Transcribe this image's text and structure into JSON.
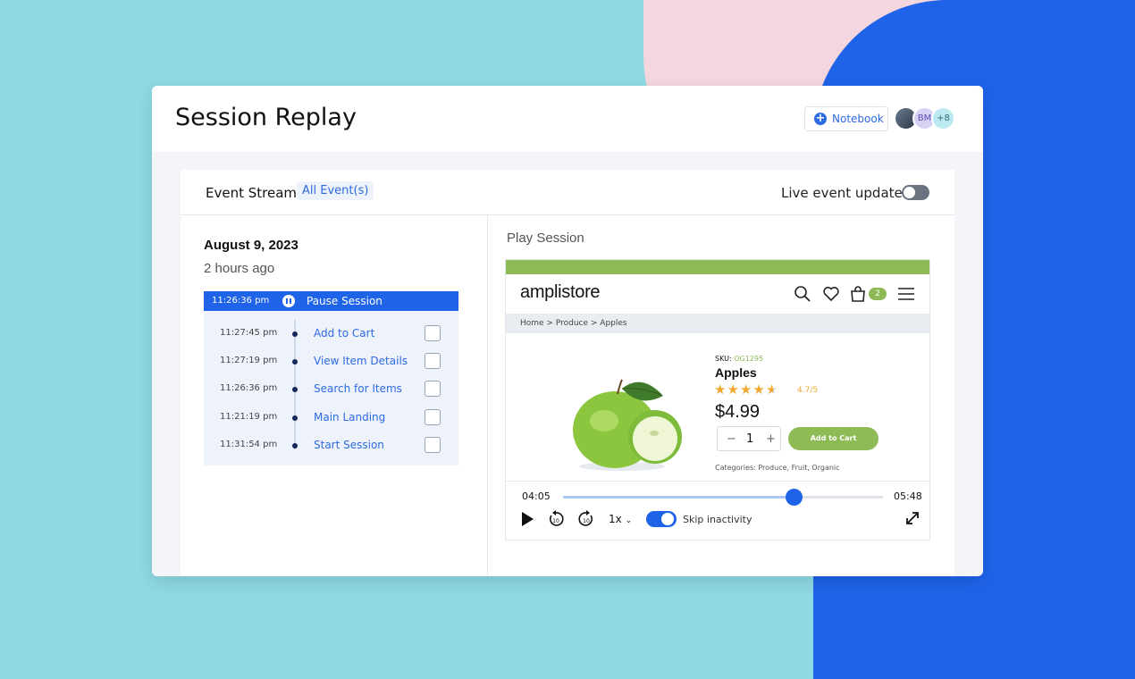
{
  "app": {
    "title": "Session Replay",
    "notebook_label": "Notebook",
    "avatars": [
      {
        "label": ""
      },
      {
        "label": "BM"
      },
      {
        "label": "+8"
      }
    ]
  },
  "event_stream": {
    "label": "Event Stream",
    "filter": "All Event(s)",
    "live_updates_label": "Live event updates",
    "live_updates_on": false,
    "date": "August 9, 2023",
    "relative_time": "2 hours ago",
    "current": {
      "time": "11:26:36 pm",
      "label": "Pause Session"
    },
    "events": [
      {
        "time": "11:27:45 pm",
        "label": "Add to Cart"
      },
      {
        "time": "11:27:19 pm",
        "label": "View Item Details"
      },
      {
        "time": "11:26:36 pm",
        "label": "Search for Items"
      },
      {
        "time": "11:21:19 pm",
        "label": "Main Landing"
      },
      {
        "time": "11:31:54 pm",
        "label": "Start Session"
      }
    ]
  },
  "player": {
    "label": "Play Session",
    "store_name": "amplistore",
    "cart_count": "2",
    "breadcrumb": "Home > Produce > Apples",
    "product": {
      "sku_label": "SKU:",
      "sku": "OG1295",
      "name": "Apples",
      "rating": "4.7/5",
      "rating_value": 4.7,
      "price": "$4.99",
      "quantity": "1",
      "add_to_cart": "Add to Cart",
      "categories": "Categories: Produce, Fruit, Organic"
    },
    "time_current": "04:05",
    "time_total": "05:48",
    "progress_fraction": 0.72,
    "speed": "1x",
    "skip_inactivity_label": "Skip inactivity",
    "skip_inactivity_on": true
  },
  "colors": {
    "accent": "#1f63e9",
    "store_green": "#8fbb57",
    "star": "#f0a832"
  }
}
